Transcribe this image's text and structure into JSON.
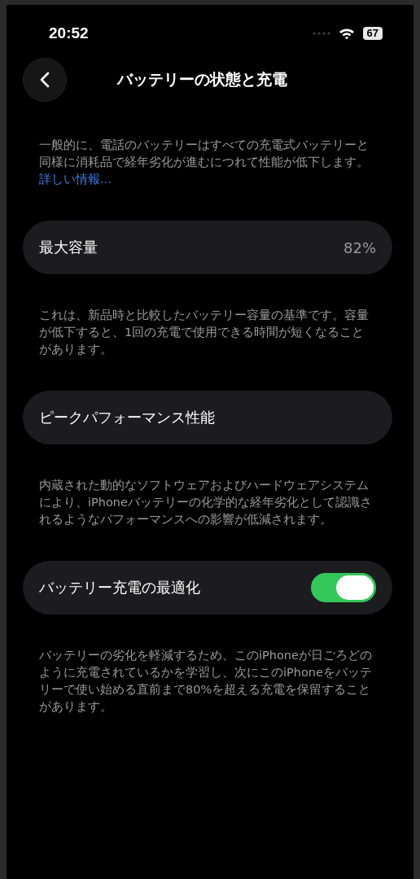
{
  "status_bar": {
    "time": "20:52",
    "battery": "67"
  },
  "nav": {
    "title": "バッテリーの状態と充電"
  },
  "intro": {
    "text": "一般的に、電話のバッテリーはすべての充電式バッテリーと同様に消耗品で経年劣化が進むにつれて性能が低下します。",
    "link": "詳しい情報..."
  },
  "sections": [
    {
      "kind": "value",
      "label": "最大容量",
      "value": "82%",
      "footnote": "これは、新品時と比較したバッテリー容量の基準です。容量が低下すると、1回の充電で使用できる時間が短くなることがあります。"
    },
    {
      "kind": "plain",
      "label": "ピークパフォーマンス性能",
      "footnote": "内蔵された動的なソフトウェアおよびハードウェアシステムにより、iPhoneバッテリーの化学的な経年劣化として認識されるようなパフォーマンスへの影響が低減されます。"
    },
    {
      "kind": "toggle",
      "label": "バッテリー充電の最適化",
      "on": true,
      "footnote": "バッテリーの劣化を軽減するため、このiPhoneが日ごろどのように充電されているかを学習し、次にこのiPhoneをバッテリーで使い始める直前まで80%を超える充電を保留することがあります。"
    }
  ]
}
